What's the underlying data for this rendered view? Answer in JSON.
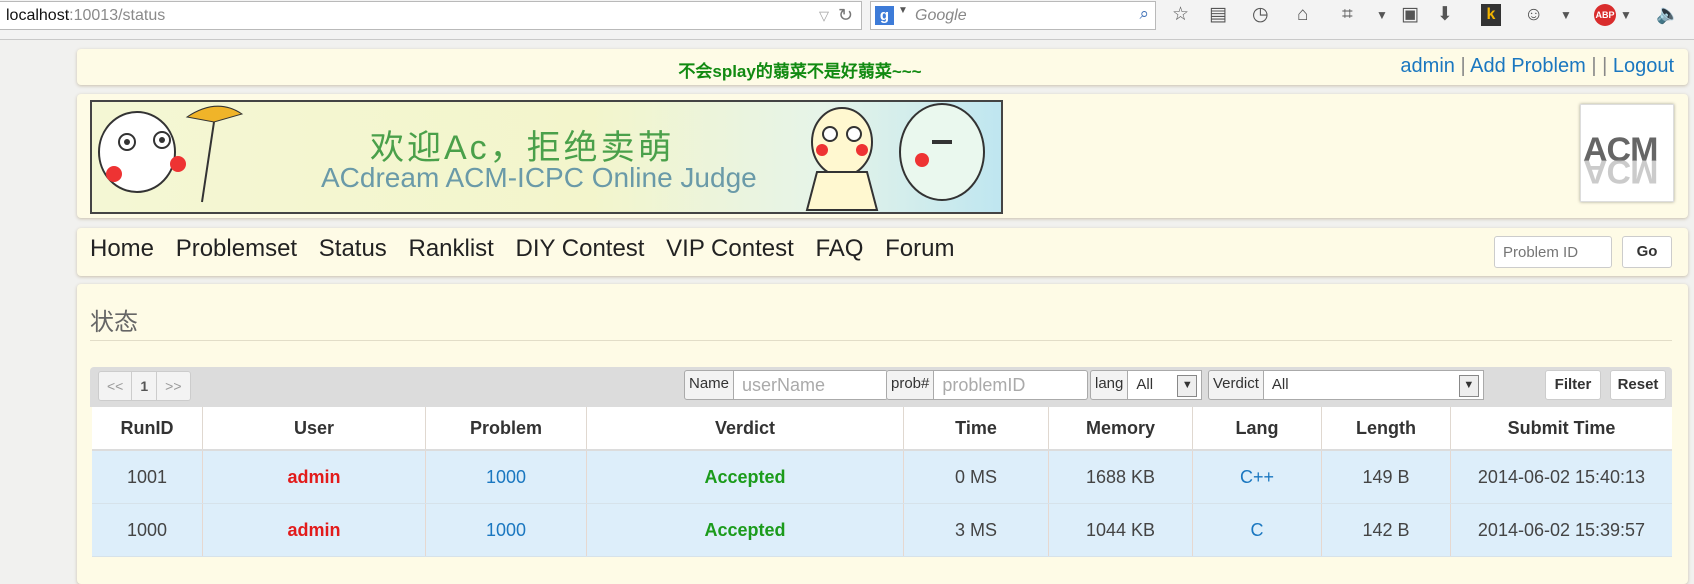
{
  "browser": {
    "url_host": "localhost",
    "url_path": ":10013/status",
    "search_placeholder": "Google"
  },
  "header": {
    "motto": "不会splay的蒻菜不是好蒻菜~~~",
    "user": "admin",
    "sep1": "|",
    "add_problem": "Add Problem",
    "sep2": "| |",
    "logout": "Logout"
  },
  "banner": {
    "title_cn": "欢迎Ac，拒绝卖萌",
    "subtitle": "ACdream ACM-ICPC Online Judge",
    "logo_text": "ACM"
  },
  "nav": {
    "items": [
      "Home",
      "Problemset",
      "Status",
      "Ranklist",
      "DIY Contest",
      "VIP Contest",
      "FAQ",
      "Forum"
    ],
    "problem_id_placeholder": "Problem ID",
    "go_label": "Go"
  },
  "page": {
    "title": "状态"
  },
  "pager": {
    "prev": "<<",
    "current": "1",
    "next": ">>"
  },
  "filters": {
    "name_label": "Name",
    "name_placeholder": "userName",
    "prob_label": "prob#",
    "prob_placeholder": "problemID",
    "lang_label": "lang",
    "lang_value": "All",
    "verdict_label": "Verdict",
    "verdict_value": "All",
    "filter_button": "Filter",
    "reset_button": "Reset"
  },
  "table": {
    "columns": [
      "RunID",
      "User",
      "Problem",
      "Verdict",
      "Time",
      "Memory",
      "Lang",
      "Length",
      "Submit Time"
    ],
    "rows": [
      {
        "runid": "1001",
        "user": "admin",
        "problem": "1000",
        "verdict": "Accepted",
        "time": "0 MS",
        "memory": "1688 KB",
        "lang": "C++",
        "length": "149 B",
        "submit": "2014-06-02 15:40:13"
      },
      {
        "runid": "1000",
        "user": "admin",
        "problem": "1000",
        "verdict": "Accepted",
        "time": "3 MS",
        "memory": "1044 KB",
        "lang": "C",
        "length": "142 B",
        "submit": "2014-06-02 15:39:57"
      }
    ]
  },
  "colors": {
    "panel_bg": "#fefbe6",
    "link": "#1a77c0",
    "user_red": "#e21b1b",
    "accepted_green": "#1b9b1b",
    "row_bg": "#ddeefa"
  }
}
